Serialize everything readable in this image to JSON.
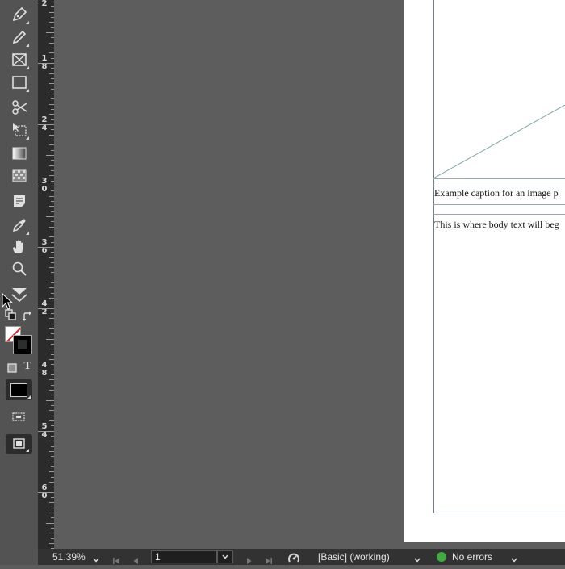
{
  "toolbar": {
    "tools": [
      {
        "icon": "pen-tool-icon"
      },
      {
        "icon": "pencil-tool-icon"
      },
      {
        "icon": "rectangle-frame-tool-icon"
      },
      {
        "icon": "rectangle-tool-icon"
      },
      {
        "icon": "scissors-tool-icon"
      },
      {
        "icon": "free-transform-tool-icon"
      },
      {
        "icon": "gradient-swatch-tool-icon"
      },
      {
        "icon": "gradient-feather-tool-icon"
      },
      {
        "icon": "note-tool-icon"
      },
      {
        "icon": "eyedropper-tool-icon"
      },
      {
        "icon": "hand-tool-icon"
      },
      {
        "icon": "zoom-tool-icon"
      }
    ],
    "type_label": "T"
  },
  "ruler": {
    "labels": [
      "2",
      "18",
      "24",
      "30",
      "36",
      "42",
      "48",
      "54",
      "60"
    ]
  },
  "page": {
    "caption": "Example caption for an image p",
    "body": "This is where body text will beg"
  },
  "statusbar": {
    "zoom": "51.39%",
    "page_number": "1",
    "style": "[Basic] (working)",
    "errors": "No errors"
  },
  "colors": {
    "toolbar_bg": "#535353",
    "pasteboard": "#5d5d5d",
    "status_ok": "#3fae3f"
  }
}
